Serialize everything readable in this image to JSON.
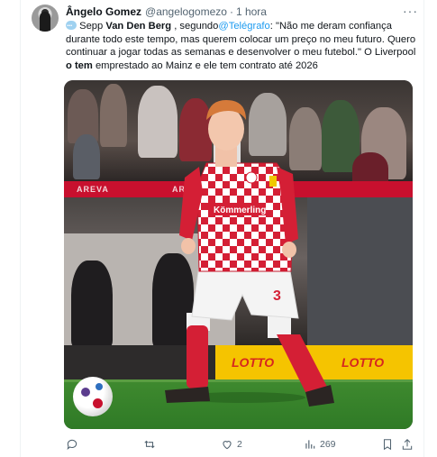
{
  "author": {
    "name": "Ângelo Gomez",
    "handle": "@angelogomezo",
    "separator": "·",
    "time": "1 hora"
  },
  "tweet": {
    "part1": "Sepp ",
    "bold1": "Van Den Berg",
    "part2": " , segundo",
    "mention": "@Telégrafo",
    "part3": ": \"Não me deram confiança durante todo este tempo, mas querem colocar um preço no meu futuro. Quero continuar a jogar todas as semanas e desenvolver o meu futebol.\" O Liverpool ",
    "bold2": "o tem",
    "part4": " emprestado ao Mainz e ele tem contrato até 2026"
  },
  "photo": {
    "board_left": "AREVA",
    "board_mid": "AREVA",
    "jersey_sponsor": "Kömmerling",
    "shirt_number": "3",
    "lotto_1": "LOTTO",
    "lotto_2": "LOTTO"
  },
  "actions": {
    "reply": {
      "icon": "reply-icon",
      "count": ""
    },
    "retweet": {
      "icon": "retweet-icon",
      "count": ""
    },
    "like": {
      "icon": "heart-icon",
      "count": "2"
    },
    "views": {
      "icon": "views-icon",
      "count": "269"
    },
    "bookmark": {
      "icon": "bookmark-icon"
    },
    "share": {
      "icon": "share-icon"
    }
  },
  "colors": {
    "link": "#1d9bf0",
    "muted": "#536471",
    "text": "#0f1419",
    "mainz_red": "#c8102e",
    "lotto_yellow": "#f5c400"
  }
}
